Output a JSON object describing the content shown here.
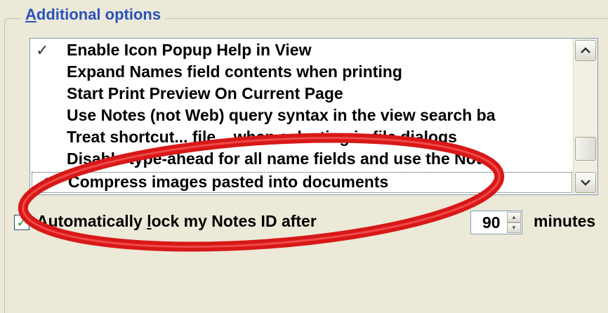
{
  "group": {
    "title_hotkey": "A",
    "title_rest": "dditional options"
  },
  "options": [
    {
      "label": "Enable Icon Popup Help in View",
      "checked": true
    },
    {
      "label": "Expand Names field contents when printing",
      "checked": false
    },
    {
      "label": "Start Print Preview On Current Page",
      "checked": false
    },
    {
      "label": "Use Notes (not Web) query syntax in the view search ba",
      "checked": false
    },
    {
      "label": "Treat shortcut... file... when selecting in file dialogs",
      "checked": false
    },
    {
      "label": "Disable type-ahead for all name fields and use the Note",
      "checked": false
    },
    {
      "label": "Compress images pasted into documents",
      "checked": true
    }
  ],
  "lock": {
    "checked": true,
    "label_pre": "Automatically ",
    "label_hotkey": "l",
    "label_post": "ock my Notes ID after",
    "value": "90",
    "unit": "minutes"
  },
  "colors": {
    "title": "#2a52be",
    "highlight": "#d81818",
    "checkbox_mark": "#21a121"
  },
  "icons": {
    "scroll_up": "chevron-up-icon",
    "scroll_down": "chevron-down-icon",
    "check": "checkmark-icon"
  }
}
